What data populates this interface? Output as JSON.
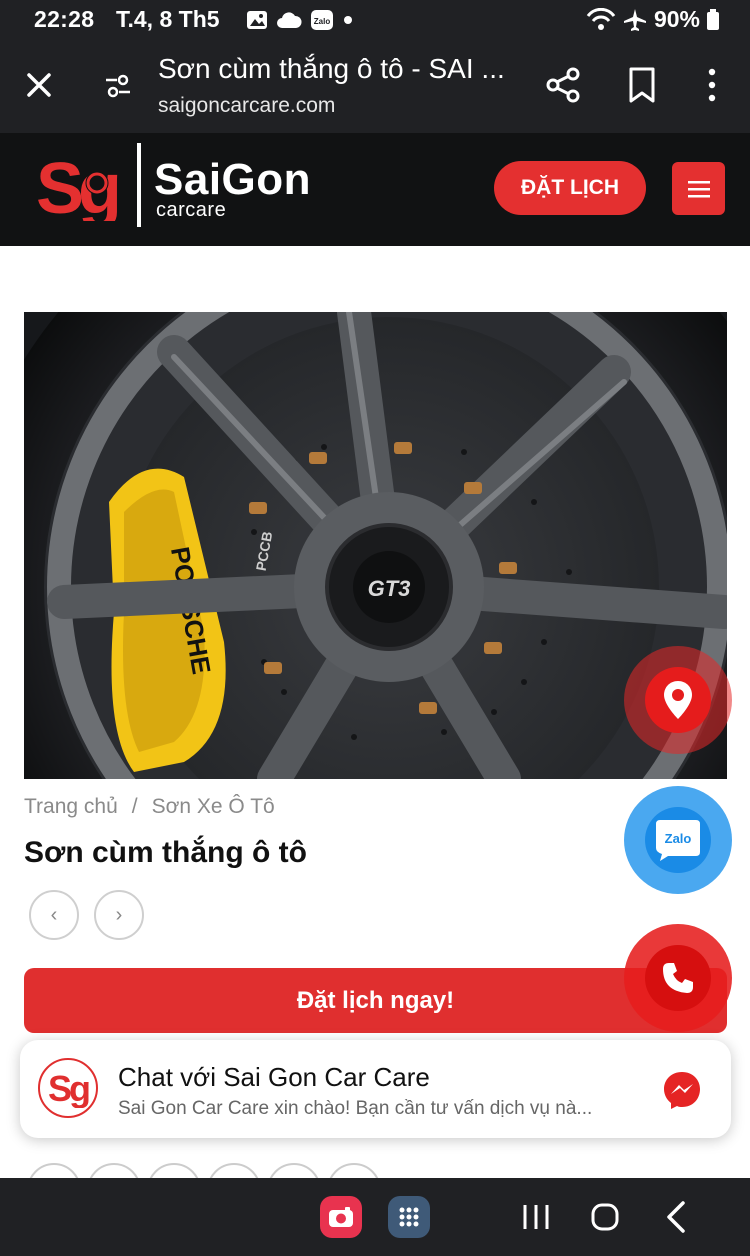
{
  "status_bar": {
    "time": "22:28",
    "date": "T.4, 8 Th5",
    "battery": "90%",
    "icons": [
      "gallery-icon",
      "cloud-icon",
      "zalo-notification-icon",
      "dot-icon",
      "wifi-calling-icon",
      "airplane-icon",
      "battery-icon"
    ]
  },
  "browser": {
    "page_title": "Sơn cùm thắng ô tô - SAI ...",
    "url": "saigoncarcare.com"
  },
  "site_header": {
    "logo_mark": "Sg",
    "logo_name": "SaiGon",
    "logo_sub": "carcare",
    "book_button": "ĐẶT LỊCH"
  },
  "hero": {
    "alt_subject": "wheel",
    "badge_text": "GT3",
    "caliper_text": "PORSCHE",
    "disc_text": "PCCB",
    "colors": {
      "caliper": "#f2c416",
      "rim": "#4d4f52",
      "disc": "#2c2e31"
    }
  },
  "breadcrumb": {
    "home": "Trang chủ",
    "separator": "/",
    "category": "Sơn Xe Ô Tô"
  },
  "page": {
    "title": "Sơn cùm thắng ô tô",
    "prev_arrow": "‹",
    "next_arrow": "›"
  },
  "cta": {
    "label": "Đặt lịch ngay!"
  },
  "chat": {
    "avatar_text": "Sg",
    "title": "Chat với Sai Gon Car Care",
    "message": "Sai Gon Car Care xin chào! Bạn cần tư vấn dịch vụ nà..."
  },
  "fabs": {
    "zalo_label": "Zalo"
  },
  "colors": {
    "brand_red": "#e43030",
    "header_bg": "#111213",
    "chrome_bg": "#202124",
    "zalo_blue": "#1a8be6"
  }
}
